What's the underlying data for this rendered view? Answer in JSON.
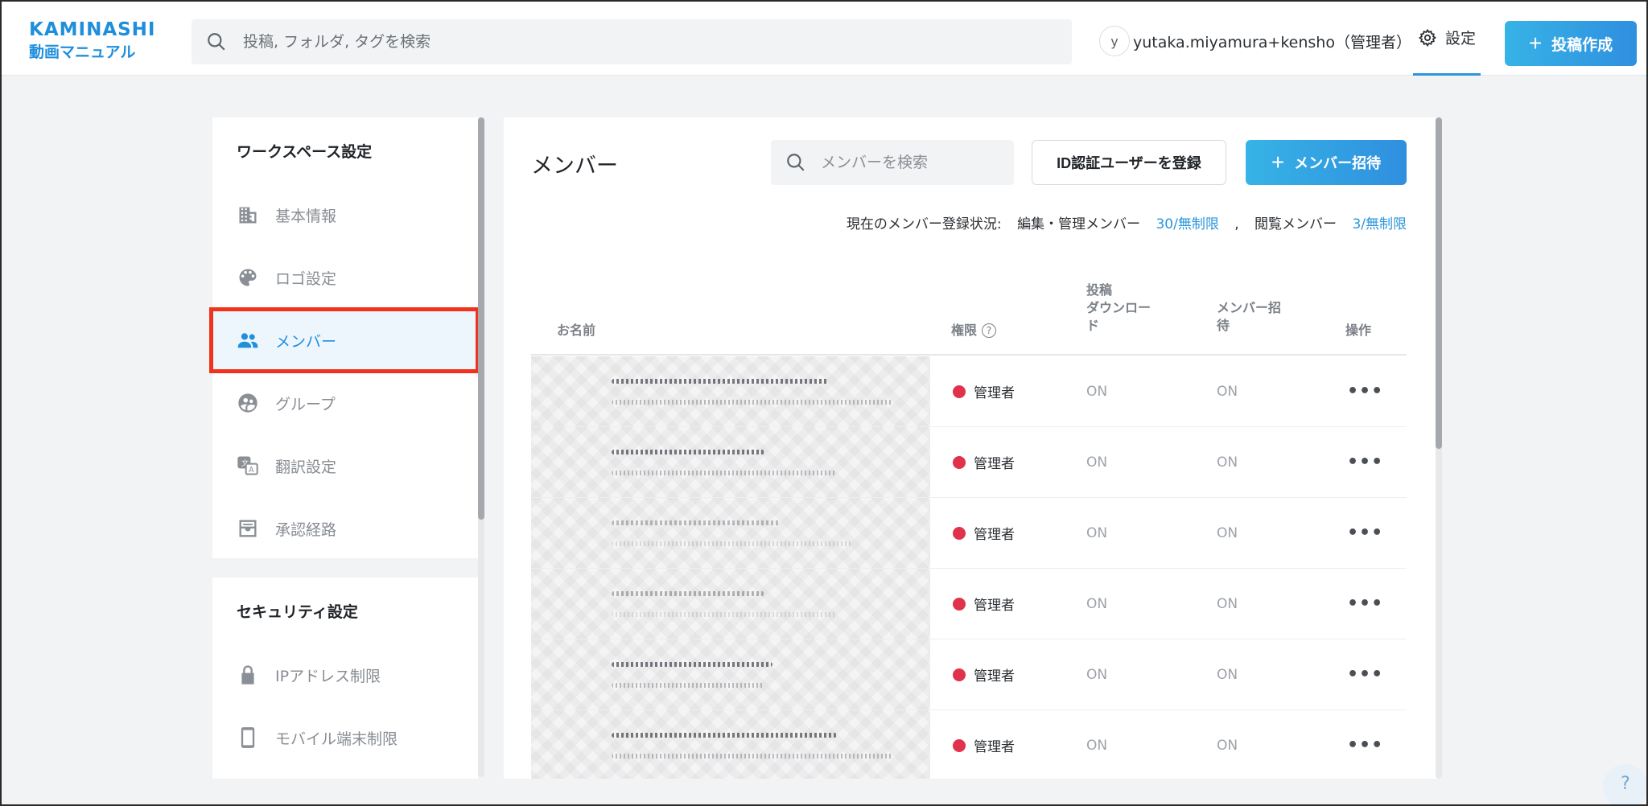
{
  "logo": {
    "line1": "KAMINASHI",
    "line2": "動画マニュアル"
  },
  "header": {
    "search_placeholder": "投稿, フォルダ, タグを検索",
    "avatar_initial": "y",
    "user_name": "yutaka.miyamura+kensho（管理者）",
    "settings_label": "設定",
    "create_label": "投稿作成"
  },
  "sidebar": {
    "workspace_title": "ワークスペース設定",
    "workspace_items": [
      {
        "label": "基本情報",
        "icon": "building-icon"
      },
      {
        "label": "ロゴ設定",
        "icon": "palette-icon"
      },
      {
        "label": "メンバー",
        "icon": "people-icon",
        "active": true
      },
      {
        "label": "グループ",
        "icon": "group-icon"
      },
      {
        "label": "翻訳設定",
        "icon": "translate-icon"
      },
      {
        "label": "承認経路",
        "icon": "inbox-icon"
      }
    ],
    "security_title": "セキュリティ設定",
    "security_items": [
      {
        "label": "IPアドレス制限",
        "icon": "lock-icon"
      },
      {
        "label": "モバイル端末制限",
        "icon": "phone-icon"
      }
    ]
  },
  "main": {
    "title": "メンバー",
    "search_placeholder": "メンバーを検索",
    "id_button": "ID認証ユーザーを登録",
    "invite_button": "メンバー招待",
    "status": {
      "prefix": "現在のメンバー登録状況:",
      "editor_label": "編集・管理メンバー",
      "editor_value": "30/無制限",
      "separator": ",",
      "viewer_label": "閲覧メンバー",
      "viewer_value": "3/無制限"
    },
    "columns": {
      "name": "お名前",
      "role": "権限",
      "download_l1": "投稿",
      "download_l2": "ダウンロー",
      "download_l3": "ド",
      "invite_l1": "メンバー招",
      "invite_l2": "待",
      "ops": "操作"
    },
    "rows": [
      {
        "role": "管理者",
        "download": "ON",
        "invite": "ON",
        "ops": "•••"
      },
      {
        "role": "管理者",
        "download": "ON",
        "invite": "ON",
        "ops": "•••"
      },
      {
        "role": "管理者",
        "download": "ON",
        "invite": "ON",
        "ops": "•••"
      },
      {
        "role": "管理者",
        "download": "ON",
        "invite": "ON",
        "ops": "•••"
      },
      {
        "role": "管理者",
        "download": "ON",
        "invite": "ON",
        "ops": "•••"
      },
      {
        "role": "管理者",
        "download": "ON",
        "invite": "ON",
        "ops": "•••"
      }
    ]
  },
  "help_label": "?",
  "colors": {
    "accent": "#2a96dc",
    "admin_dot": "#e0324a",
    "highlight_border": "#f0331c"
  }
}
